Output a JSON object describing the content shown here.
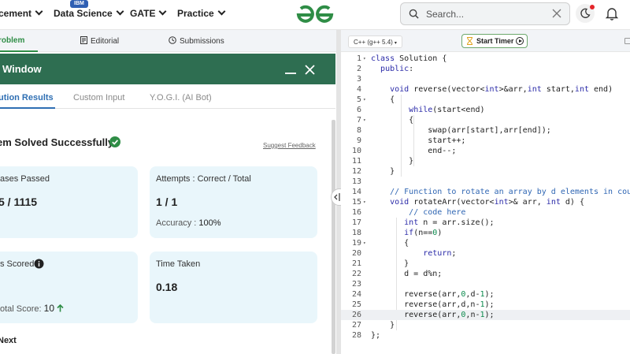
{
  "nav": {
    "items": [
      {
        "label": "cement"
      },
      {
        "label": "Data Science"
      },
      {
        "label": "GATE"
      },
      {
        "label": "Practice"
      }
    ],
    "badge": "IBM",
    "search_placeholder": "Search..."
  },
  "problem_tabs": [
    "roblem",
    "Editorial",
    "Submissions"
  ],
  "result_window": {
    "title": "t Window",
    "tabs": [
      "ution Results",
      "Custom Input",
      "Y.O.G.I. (AI Bot)"
    ],
    "status": "em Solved Successfully",
    "suggest_feedback": "Suggest Feedback",
    "cards": {
      "cases_label": "ases Passed",
      "cases_value": "5 / 1115",
      "attempts_label": "Attempts : Correct / Total",
      "attempts_value": "1 / 1",
      "accuracy_label": "Accuracy :",
      "accuracy_value": "100%",
      "score_label": "s Scored",
      "total_score_label": "otal Score:",
      "total_score_value": "10",
      "time_label": "Time Taken",
      "time_value": "0.18"
    },
    "next": "Next"
  },
  "editor": {
    "language": "C++ (g++ 5.4)",
    "timer_label": "Start Timer",
    "active_line": 26,
    "lines": [
      "class Solution {",
      "  public:",
      "",
      "    void reverse(vector<int>&arr,int start,int end)",
      "    {",
      "        while(start<end)",
      "        {",
      "            swap(arr[start],arr[end]);",
      "            start++;",
      "            end--;",
      "        }",
      "    }",
      "",
      "    // Function to rotate an array by d elements in counter-",
      "    void rotateArr(vector<int>& arr, int d) {",
      "        // code here",
      "       int n = arr.size();",
      "       if(n==0)",
      "       {",
      "           return;",
      "       }",
      "       d = d%n;",
      "",
      "       reverse(arr,0,d-1);",
      "       reverse(arr,d,n-1);",
      "       reverse(arr,0,n-1);",
      "    }",
      "};"
    ]
  },
  "colors": {
    "brand_green": "#2f8d46",
    "header_green": "#2e6e51",
    "link_blue": "#2f6fb3",
    "card_bg": "#e9f6fb"
  }
}
